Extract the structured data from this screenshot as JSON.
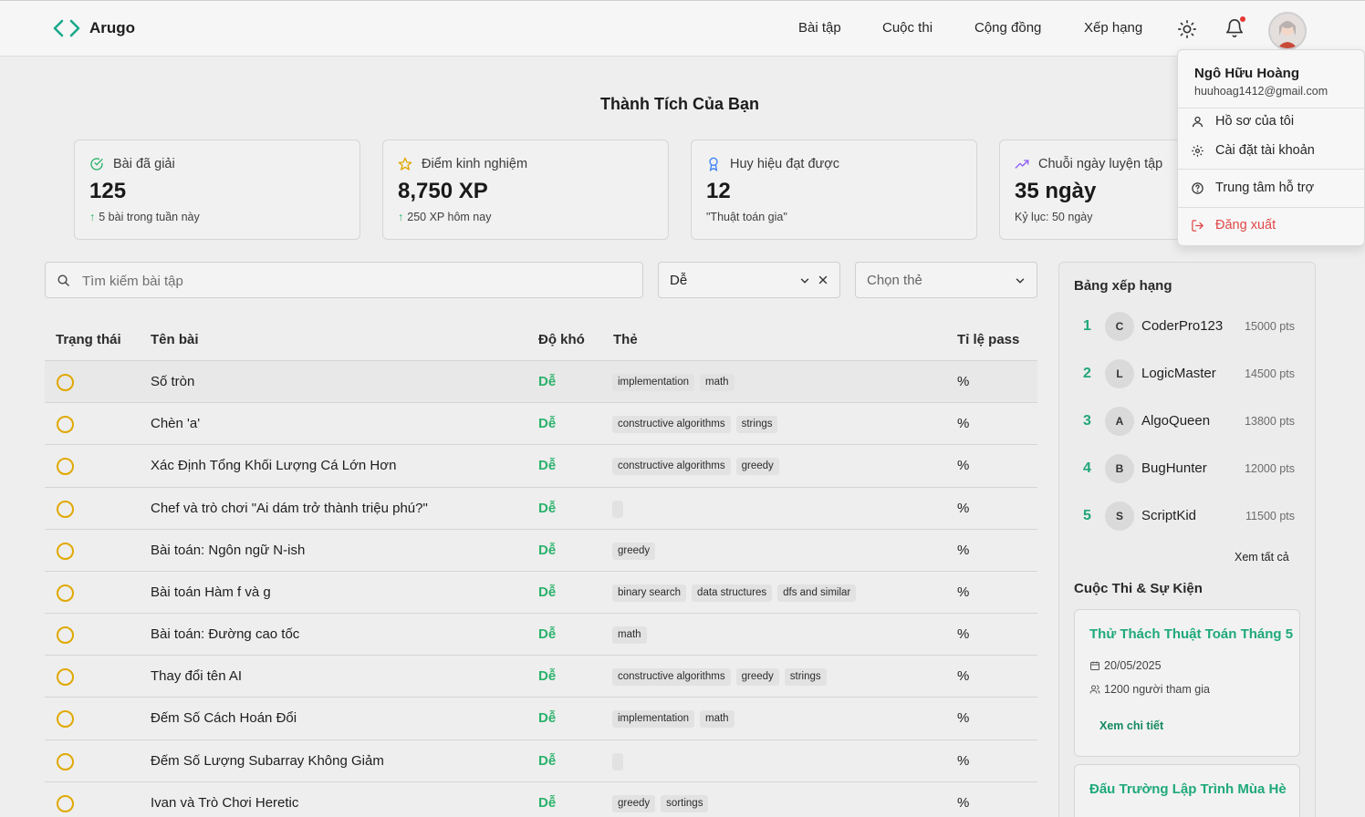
{
  "app": {
    "name": "Arugo"
  },
  "nav": [
    "Bài tập",
    "Cuộc thi",
    "Cộng đồng",
    "Xếp hạng"
  ],
  "page_title": "Thành Tích Của Bạn",
  "stats": [
    {
      "label": "Bài đã giải",
      "value": "125",
      "sub": "5 bài trong tuần này",
      "icon": "check-circle-icon",
      "color": "#2ab26b"
    },
    {
      "label": "Điểm kinh nghiệm",
      "value": "8,750 XP",
      "sub": "250 XP hôm nay",
      "icon": "star-icon",
      "color": "#e0a800"
    },
    {
      "label": "Huy hiệu đạt được",
      "value": "12",
      "sub": "\"Thuật toán gia\"",
      "icon": "award-icon",
      "color": "#3b82f6"
    },
    {
      "label": "Chuỗi ngày luyện tập",
      "value": "35 ngày",
      "sub": "Kỷ lục: 50 ngày",
      "icon": "trending-up-icon",
      "color": "#8b5cf6"
    }
  ],
  "filters": {
    "search_placeholder": "Tìm kiếm bài tập",
    "difficulty_value": "Dễ",
    "tag_placeholder": "Chọn thẻ"
  },
  "table": {
    "headers": [
      "Trạng thái",
      "Tên bài",
      "Độ khó",
      "Thẻ",
      "Tỉ lệ pass"
    ],
    "rows": [
      {
        "name": "Số tròn",
        "difficulty": "Dễ",
        "tags": [
          "implementation",
          "math"
        ],
        "rate": "%"
      },
      {
        "name": "Chèn 'a'",
        "difficulty": "Dễ",
        "tags": [
          "constructive algorithms",
          "strings"
        ],
        "rate": "%"
      },
      {
        "name": "Xác Định Tổng Khối Lượng Cá Lớn Hơn",
        "difficulty": "Dễ",
        "tags": [
          "constructive algorithms",
          "greedy"
        ],
        "rate": "%"
      },
      {
        "name": "Chef và trò chơi \"Ai dám trở thành triệu phú?\"",
        "difficulty": "Dễ",
        "tags": [],
        "rate": "%"
      },
      {
        "name": "Bài toán: Ngôn ngữ N-ish",
        "difficulty": "Dễ",
        "tags": [
          "greedy"
        ],
        "rate": "%"
      },
      {
        "name": "Bài toán Hàm f và g",
        "difficulty": "Dễ",
        "tags": [
          "binary search",
          "data structures",
          "dfs and similar"
        ],
        "rate": "%"
      },
      {
        "name": "Bài toán: Đường cao tốc",
        "difficulty": "Dễ",
        "tags": [
          "math"
        ],
        "rate": "%"
      },
      {
        "name": "Thay đổi tên AI",
        "difficulty": "Dễ",
        "tags": [
          "constructive algorithms",
          "greedy",
          "strings"
        ],
        "rate": "%"
      },
      {
        "name": "Đếm Số Cách Hoán Đổi",
        "difficulty": "Dễ",
        "tags": [
          "implementation",
          "math"
        ],
        "rate": "%"
      },
      {
        "name": "Đếm Số Lượng Subarray Không Giảm",
        "difficulty": "Dễ",
        "tags": [],
        "rate": "%"
      },
      {
        "name": "Ivan và Trò Chơi Heretic",
        "difficulty": "Dễ",
        "tags": [
          "greedy",
          "sortings"
        ],
        "rate": "%"
      }
    ]
  },
  "leaderboard": {
    "title": "Bảng xếp hạng",
    "entries": [
      {
        "rank": "1",
        "initial": "C",
        "name": "CoderPro123",
        "points": "15000 pts"
      },
      {
        "rank": "2",
        "initial": "L",
        "name": "LogicMaster",
        "points": "14500 pts"
      },
      {
        "rank": "3",
        "initial": "A",
        "name": "AlgoQueen",
        "points": "13800 pts"
      },
      {
        "rank": "4",
        "initial": "B",
        "name": "BugHunter",
        "points": "12000 pts"
      },
      {
        "rank": "5",
        "initial": "S",
        "name": "ScriptKid",
        "points": "11500 pts"
      }
    ],
    "see_all": "Xem tất cả"
  },
  "events": {
    "title": "Cuộc Thi & Sự Kiện",
    "items": [
      {
        "title": "Thử Thách Thuật Toán Tháng 5",
        "date": "20/05/2025",
        "participants": "1200 người tham gia",
        "link": "Xem chi tiết"
      },
      {
        "title": "Đấu Trường Lập Trình Mùa Hè"
      }
    ]
  },
  "user_menu": {
    "name": "Ngô Hữu Hoàng",
    "email": "huuhoag1412@gmail.com",
    "items": [
      "Hồ sơ của tôi",
      "Cài đặt tài khoản",
      "Trung tâm hỗ trợ",
      "Đăng xuất"
    ]
  }
}
